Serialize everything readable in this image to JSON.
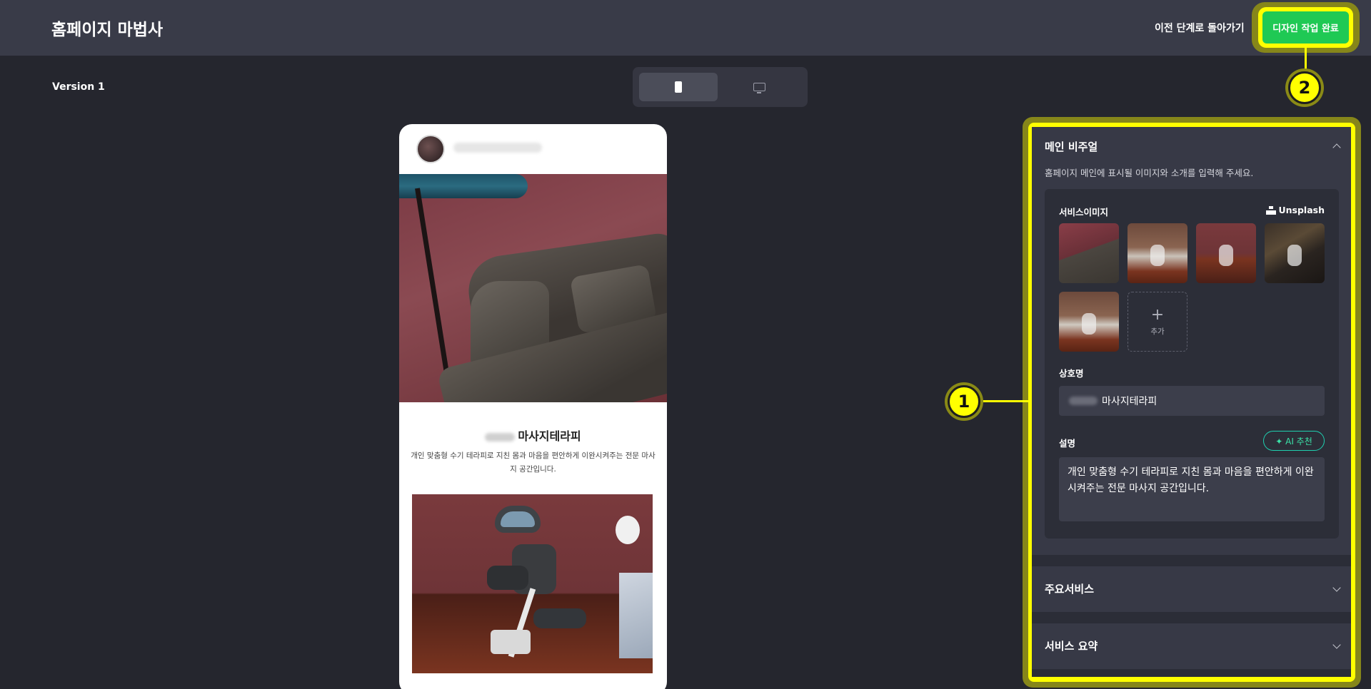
{
  "header": {
    "app_title": "홈페이지 마법사",
    "back_link": "이전 단계로 돌아가기",
    "done_button": "디자인 작업 완료"
  },
  "toolbar": {
    "version": "Version 1",
    "device_mobile_icon": "mobile-icon",
    "device_desktop_icon": "monitor-icon"
  },
  "preview": {
    "business_name": "마사지테라피",
    "description": "개인 맞춤형 수기 테라피로 지친 몸과 마음을 편안하게 이완시켜주는 전문 마사지 공간입니다.",
    "carousel_count": 5,
    "carousel_active": 1
  },
  "panel": {
    "main_visual": {
      "title": "메인 비주얼",
      "subtitle": "홈페이지 메인에 표시될 이미지와 소개를 입력해 주세요.",
      "images_label": "서비스이미지",
      "unsplash_label": "Unsplash",
      "add_label": "추가",
      "name_label": "상호명",
      "name_value": "마사지테라피",
      "desc_label": "설명",
      "ai_button": "✦ AI 추천",
      "desc_value": "개인 맞춤형 수기 테라피로 지친 몸과 마음을 편안하게 이완시켜주는 전문 마사지 공간입니다."
    },
    "main_services": {
      "title": "주요서비스"
    },
    "service_summary": {
      "title": "서비스 요약"
    }
  },
  "annotations": {
    "marker_1": "1",
    "marker_2": "2"
  },
  "colors": {
    "accent_green": "#1fc954",
    "highlight_yellow": "#ffff00",
    "background": "#25262e",
    "header": "#393b48"
  }
}
